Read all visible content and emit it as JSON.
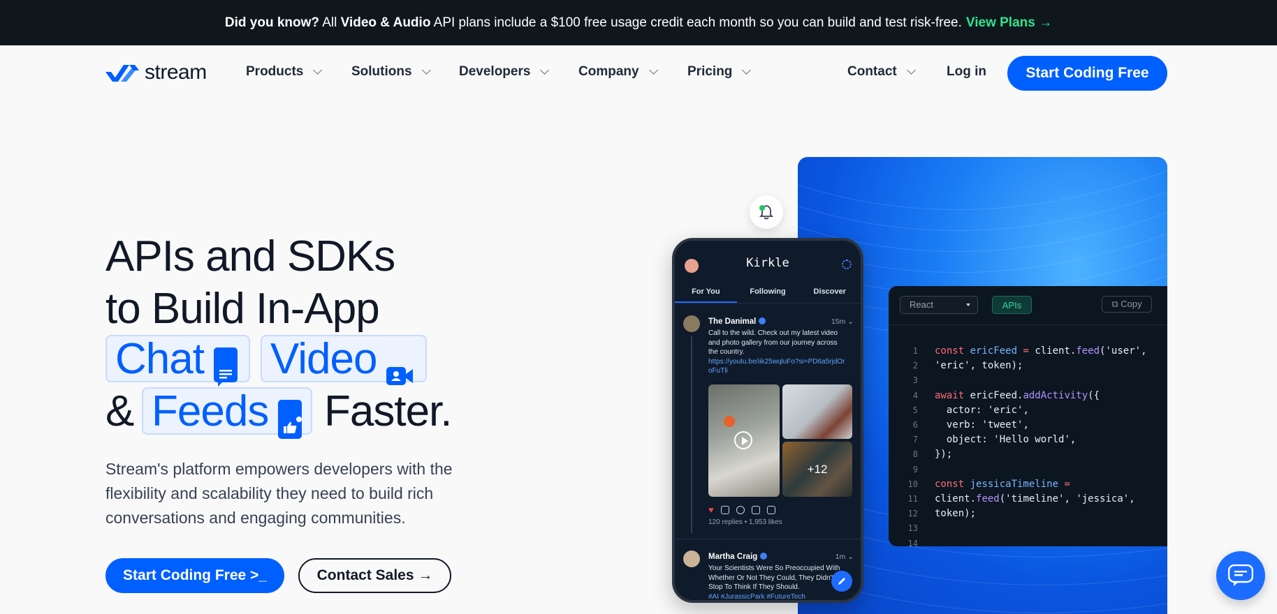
{
  "announcement": {
    "lead": "Did you know?",
    "text1": " All ",
    "bold": "Video & Audio",
    "text2": " API plans include a $100 free usage credit each month so you can build and test risk-free.",
    "link": "View Plans →"
  },
  "nav": {
    "logo": "stream",
    "items": [
      "Products",
      "Solutions",
      "Developers",
      "Company",
      "Pricing"
    ],
    "contact": "Contact",
    "login": "Log in",
    "cta": "Start Coding Free"
  },
  "hero": {
    "line1": "APIs and SDKs",
    "line2": "to Build In-App",
    "chat": "Chat",
    "video": "Video",
    "amp": "&",
    "feeds": "Feeds",
    "faster": "Faster.",
    "description": "Stream's platform empowers developers with the flexibility and scalability they need to build rich conversations and engaging communities.",
    "cta_primary": "Start Coding Free >_",
    "cta_secondary": "Contact Sales →"
  },
  "phone": {
    "app_title": "Kirkle",
    "tabs": [
      "For You",
      "Following",
      "Discover"
    ],
    "post1": {
      "name": "The Danimal",
      "time": "15m",
      "text": "Call to the wild. Check out my latest video and photo gallery from our journey across the country.",
      "link": "https://youtu.be/iik25wqluFo?si=PD6a5rjdOroFuTli",
      "more_count": "+12",
      "stats": "120 replies • 1,953 likes"
    },
    "post2": {
      "name": "Martha Craig",
      "time": "1m",
      "text": "Your Scientists Were So Preoccupied With Whether Or Not They Could, They Didn't Stop To Think If They Should.",
      "tags": "#AI #JurassicPark #FutureTech"
    }
  },
  "code": {
    "framework": "React",
    "tab": "APIs",
    "copy": "Copy"
  },
  "colors": {
    "brand": "#005fff",
    "accent_green": "#2ee68b",
    "dark": "#0f171d"
  }
}
